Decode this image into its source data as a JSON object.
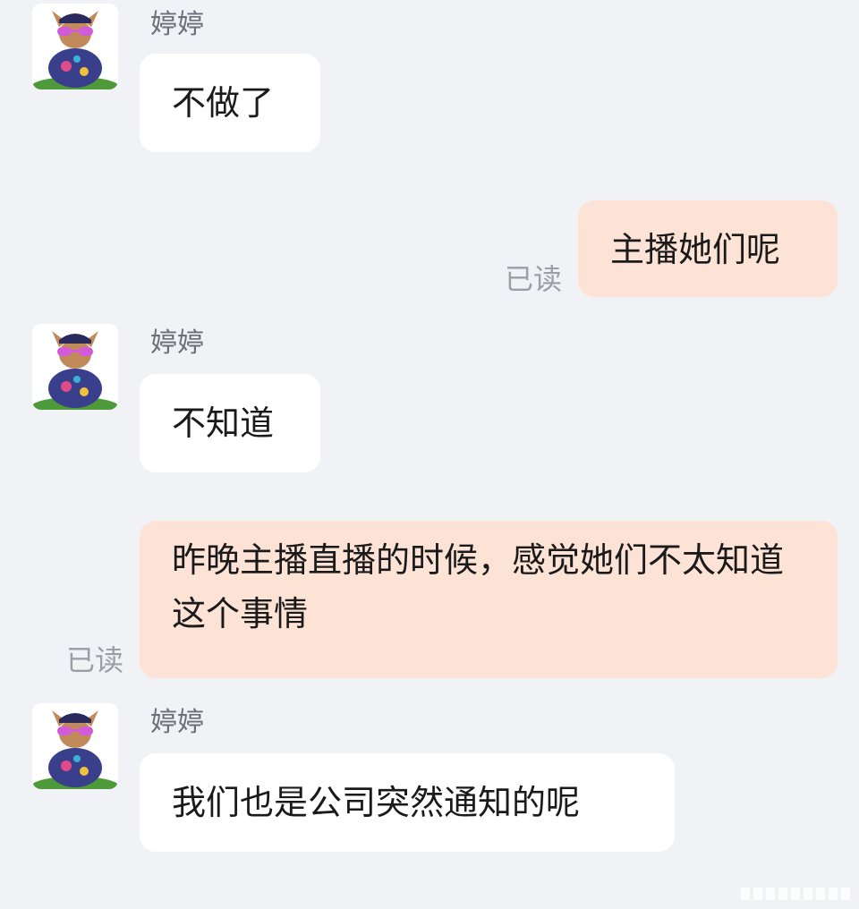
{
  "conversation": {
    "contact_name": "婷婷",
    "read_label": "已读",
    "messages": [
      {
        "direction": "incoming",
        "sender": "婷婷",
        "text": "不做了"
      },
      {
        "direction": "outgoing",
        "text": "主播她们呢",
        "status": "已读"
      },
      {
        "direction": "incoming",
        "sender": "婷婷",
        "text": "不知道"
      },
      {
        "direction": "outgoing",
        "text": "昨晚主播直播的时候，感觉她们不太知道这个事情",
        "status": "已读"
      },
      {
        "direction": "incoming",
        "sender": "婷婷",
        "text": "我们也是公司突然通知的呢"
      }
    ]
  },
  "colors": {
    "background": "#f1f2f6",
    "incoming_bubble": "#ffffff",
    "outgoing_bubble": "#fde3d6",
    "name_text": "#6c6f78",
    "read_text": "#9b9ea6"
  },
  "icons": {
    "avatar": "chihuahua-avatar-icon"
  }
}
